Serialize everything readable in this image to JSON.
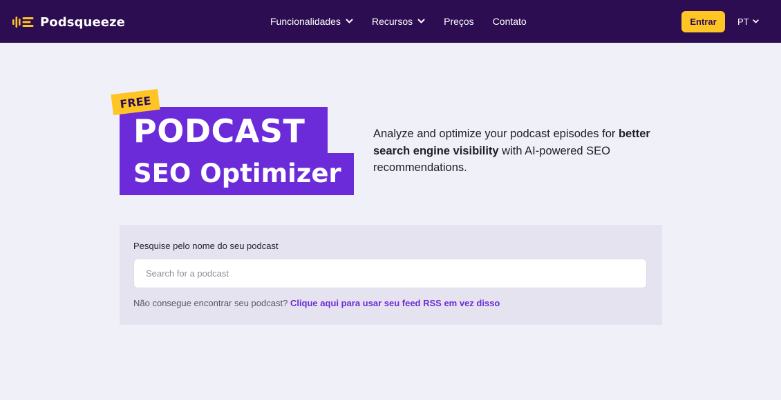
{
  "brand": {
    "name": "Podsqueeze",
    "accent": "#ffc525",
    "primary": "#6b2bd9",
    "nav_bg": "#2c0d52"
  },
  "nav": {
    "links": [
      {
        "label": "Funcionalidades",
        "icon": "chevron-down-icon"
      },
      {
        "label": "Recursos",
        "icon": "chevron-down-icon"
      },
      {
        "label": "Preços"
      },
      {
        "label": "Contato"
      }
    ],
    "login_label": "Entrar",
    "language": "PT"
  },
  "hero": {
    "badge": "FREE",
    "title_line1": "PODCAST",
    "title_line2": "SEO Optimizer",
    "desc_part1": "Analyze and optimize your podcast episodes for ",
    "desc_bold": "better search engine visibility",
    "desc_part2": " with AI-powered SEO recommendations."
  },
  "search": {
    "label": "Pesquise pelo nome do seu podcast",
    "placeholder": "Search for a podcast",
    "value": "",
    "help_text": "Não consegue encontrar seu podcast? ",
    "help_link": "Clique aqui para usar seu feed RSS em vez disso"
  }
}
